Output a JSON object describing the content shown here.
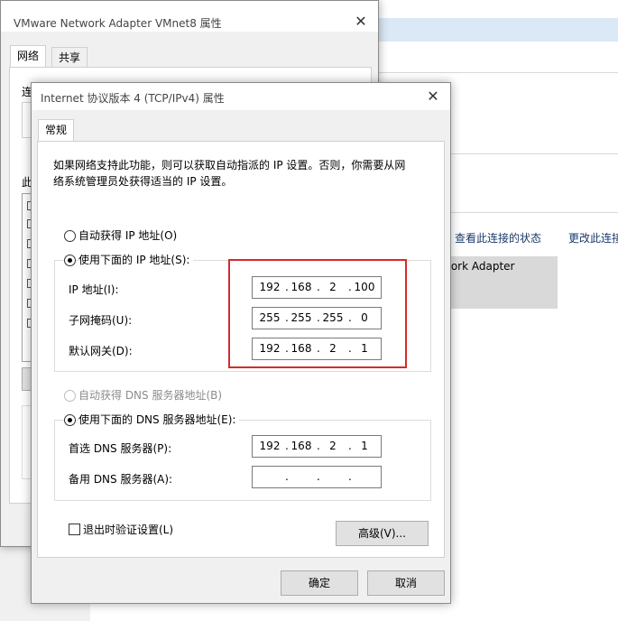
{
  "background_window": {
    "toolbar_status": "查看此连接的状态",
    "toolbar_change": "更改此连接",
    "adapter_label_partial": "work Adapter"
  },
  "adapter_dialog": {
    "title": "VMware Network Adapter VMnet8 属性",
    "tabs": [
      "网络",
      "共享"
    ],
    "partial_label_connect": "连",
    "partial_label_this": "此"
  },
  "ipv4_dialog": {
    "title": "Internet 协议版本 4 (TCP/IPv4) 属性",
    "tab": "常规",
    "description": [
      "如果网络支持此功能，则可以获取自动指派的 IP 设置。否则，你需要从网",
      "络系统管理员处获得适当的 IP 设置。"
    ],
    "auto_ip_label": "自动获得 IP 地址(O)",
    "manual_ip_label": "使用下面的 IP 地址(S):",
    "ip_label": "IP 地址(I):",
    "ip_value": [
      "192",
      "168",
      "2",
      "100"
    ],
    "subnet_label": "子网掩码(U):",
    "subnet_value": [
      "255",
      "255",
      "255",
      "0"
    ],
    "gateway_label": "默认网关(D):",
    "gateway_value": [
      "192",
      "168",
      "2",
      "1"
    ],
    "auto_dns_label": "自动获得 DNS 服务器地址(B)",
    "manual_dns_label": "使用下面的 DNS 服务器地址(E):",
    "preferred_dns_label": "首选 DNS 服务器(P):",
    "preferred_dns_value": [
      "192",
      "168",
      "2",
      "1"
    ],
    "alternate_dns_label": "备用 DNS 服务器(A):",
    "alternate_dns_value": [
      "",
      "",
      "",
      ""
    ],
    "validate_label": "退出时验证设置(L)",
    "advanced_button": "高级(V)...",
    "ok_button": "确定",
    "cancel_button": "取消",
    "highlight_color": "#d62b2b"
  }
}
